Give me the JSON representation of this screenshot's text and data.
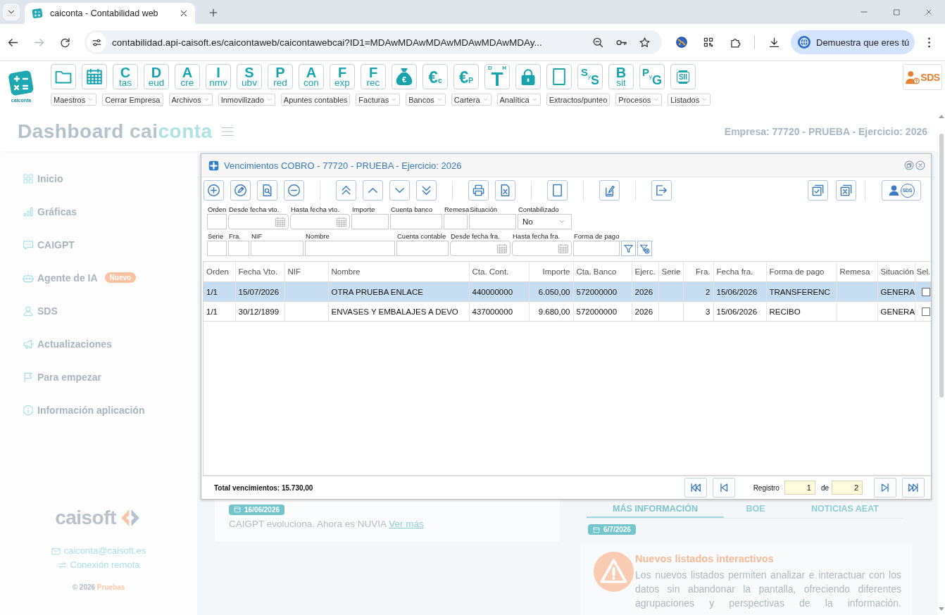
{
  "browser": {
    "tab": {
      "title": "caiconta - Contabilidad web",
      "selected": true
    },
    "nav": [
      {
        "kind": "back",
        "disabled": false
      },
      {
        "kind": "forward",
        "disabled": true
      },
      {
        "kind": "reload",
        "disabled": false
      }
    ],
    "url": "contabilidad.api-caisoft.es/caicontaweb/caicontawebcai?ID1=MDAwMDAwMDAwMDAwMDAwMDAy...",
    "profile": "Demuestra que eres tú"
  },
  "app": {
    "logo_text": "caiconta",
    "tools": [
      {
        "kind": "folder"
      },
      {
        "kind": "calendar"
      },
      {
        "kind": "letters",
        "main": "C",
        "sub": "tas"
      },
      {
        "kind": "letters",
        "main": "D",
        "sub": "eud"
      },
      {
        "kind": "letters",
        "main": "A",
        "sub": "cre"
      },
      {
        "kind": "letters",
        "main": "I",
        "sub": "nmv"
      },
      {
        "kind": "letters",
        "main": "S",
        "sub": "ubv"
      },
      {
        "kind": "letters",
        "main": "P",
        "sub": "red"
      },
      {
        "kind": "letters",
        "main": "A",
        "sub": "con"
      },
      {
        "kind": "letters",
        "main": "F",
        "sub": "exp"
      },
      {
        "kind": "letters",
        "main": "F",
        "sub": "rec"
      },
      {
        "kind": "bag",
        "main": "€"
      },
      {
        "kind": "euro",
        "main": "€",
        "sub": "c"
      },
      {
        "kind": "euro",
        "main": "€",
        "sub": "P"
      },
      {
        "kind": "dh",
        "main": "T",
        "left": "D",
        "right": "H"
      },
      {
        "kind": "lock"
      },
      {
        "kind": "page"
      },
      {
        "kind": "pair",
        "main": "S",
        "mid": "y",
        "end": "S"
      },
      {
        "kind": "letters",
        "main": "B",
        "sub": "sit"
      },
      {
        "kind": "pair",
        "main": "P",
        "mid": "y",
        "end": "G"
      },
      {
        "kind": "label",
        "main": "SII"
      }
    ],
    "menus": [
      {
        "label": "Maestros",
        "dropdown": true
      },
      {
        "label": "Cerrar Empresa",
        "dropdown": false
      },
      {
        "label": "Archivos",
        "dropdown": true
      },
      {
        "label": "Inmovilizado",
        "dropdown": true
      },
      {
        "label": "Apuntes contables",
        "dropdown": false
      },
      {
        "label": "Facturas",
        "dropdown": true
      },
      {
        "label": "Bancos",
        "dropdown": true
      },
      {
        "label": "Cartera",
        "dropdown": true
      },
      {
        "label": "Analítica",
        "dropdown": true
      },
      {
        "label": "Extractos/punteo",
        "dropdown": false
      },
      {
        "label": "Procesos",
        "dropdown": true
      },
      {
        "label": "Listados",
        "dropdown": true
      }
    ],
    "sds_label": "SDS"
  },
  "dashboard": {
    "title": "Dashboard",
    "brand": [
      "cai",
      "conta"
    ],
    "company": "Empresa: 77720 - PRUEBA - Ejercicio: 2026"
  },
  "sidebar": {
    "items": [
      {
        "kind": "home",
        "label": "Inicio"
      },
      {
        "kind": "chart",
        "label": "Gráficas"
      },
      {
        "kind": "chat",
        "label": "CAIGPT"
      },
      {
        "kind": "robot",
        "label": "Agente de IA",
        "badge": "Nuevo"
      },
      {
        "kind": "user",
        "label": "SDS"
      },
      {
        "kind": "megaphone",
        "label": "Actualizaciones"
      },
      {
        "kind": "flag",
        "label": "Para empezar"
      },
      {
        "kind": "info",
        "label": "Información aplicación"
      }
    ],
    "brand": "caisoft",
    "email": "caiconta@caisoft.es",
    "remote": "Conexión remota",
    "copyright": "© 2026",
    "environment": "Pruebas"
  },
  "news": {
    "date": "16/06/2026",
    "text": "CAIGPT evoluciona. Ahora es NUVIA",
    "link": "Ver más"
  },
  "info_panel": {
    "tabs": [
      {
        "label": "MÁS INFORMACIÓN",
        "selected": true
      },
      {
        "label": "BOE",
        "selected": false
      },
      {
        "label": "NOTICIAS AEAT",
        "selected": false
      }
    ],
    "date": "6/7/2026",
    "item": {
      "title": "Nuevos listados interactivos",
      "body": "Los nuevos listados permiten analizar e interactuar con los datos sin abandonar la pantalla, ofreciendo diferentes agrupaciones y perspectivas de la información."
    }
  },
  "modal": {
    "title": "Vencimientos COBRO - 77720 - PRUEBA - Ejercicio: 2026",
    "help_label": "SDS",
    "filters": [
      [
        {
          "label": "Orden",
          "kind": "text"
        },
        {
          "label": "Desde fecha vto.",
          "kind": "date"
        },
        {
          "label": "Hasta fecha vto.",
          "kind": "date"
        },
        {
          "label": "Importe",
          "kind": "text"
        },
        {
          "label": "Cuenta banco",
          "kind": "text"
        },
        {
          "label": "Remesa",
          "kind": "text"
        },
        {
          "label": "Situación",
          "kind": "text"
        },
        {
          "label": "Contabilizado",
          "kind": "select",
          "value": "No"
        }
      ],
      [
        {
          "label": "Serie",
          "kind": "text"
        },
        {
          "label": "Fra.",
          "kind": "text"
        },
        {
          "label": "NIF",
          "kind": "text"
        },
        {
          "label": "Nombre",
          "kind": "text"
        },
        {
          "label": "Cuenta contable",
          "kind": "text"
        },
        {
          "label": "Desde fecha fra.",
          "kind": "date"
        },
        {
          "label": "Hasta fecha fra.",
          "kind": "date"
        },
        {
          "label": "Forma de pago",
          "kind": "text"
        }
      ]
    ],
    "columns": [
      "Orden",
      "Fecha Vto.",
      "NIF",
      "Nombre",
      "Cta. Cont.",
      "Importe",
      "Cta. Banco",
      "Ejerc.",
      "Serie",
      "Fra.",
      "Fecha fra.",
      "Forma de pago",
      "Remesa",
      "Situación",
      "Sel."
    ],
    "rows": [
      {
        "selected": true,
        "orden": "1/1",
        "fecha_vto": "15/07/2026",
        "nombre": "OTRA PRUEBA ENLACE",
        "cta_cont": "440000000",
        "importe": "6.050,00",
        "cta_banco": "572000000",
        "ejerc": "2026",
        "fra": "2",
        "fecha_fra": "15/06/2026",
        "forma_pago": "TRANSFERENC",
        "situacion": "GENERA",
        "checked": false
      },
      {
        "selected": false,
        "orden": "1/1",
        "fecha_vto": "30/12/1899",
        "nombre": "ENVASES Y EMBALAJES A DEVO",
        "cta_cont": "437000000",
        "importe": "9.680,00",
        "cta_banco": "572000000",
        "ejerc": "2026",
        "fra": "3",
        "fecha_fra": "15/06/2026",
        "forma_pago": "RECIBO",
        "situacion": "GENERA",
        "checked": false
      }
    ],
    "total": "Total vencimientos: 15.730,00",
    "pager": {
      "label": "Registro",
      "current": "1",
      "of": "de",
      "count": "2"
    }
  }
}
